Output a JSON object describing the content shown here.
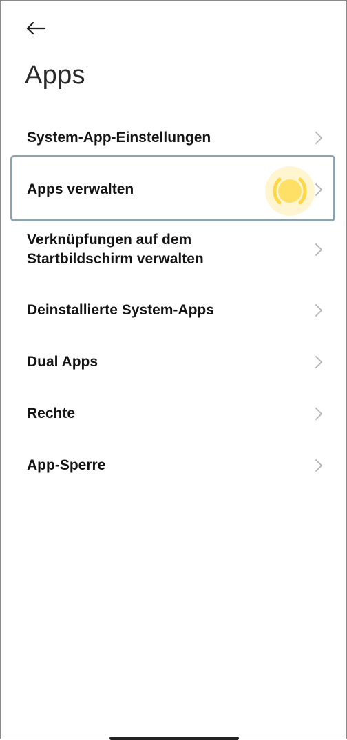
{
  "header": {
    "back_icon": "arrow-left-icon",
    "title": "Apps"
  },
  "menu": {
    "items": [
      {
        "label": "System-App-Einstellungen"
      },
      {
        "label": "Apps verwalten"
      },
      {
        "label": "Verknüpfungen auf dem\nStartbildschirm verwalten"
      },
      {
        "label": "Deinstallierte System-Apps"
      },
      {
        "label": "Dual Apps"
      },
      {
        "label": "Rechte"
      },
      {
        "label": "App-Sperre"
      }
    ],
    "chevron_icon": "chevron-right-icon"
  },
  "colors": {
    "highlight_border": "#8fa3ad",
    "tap_indicator": "#ffe066"
  }
}
